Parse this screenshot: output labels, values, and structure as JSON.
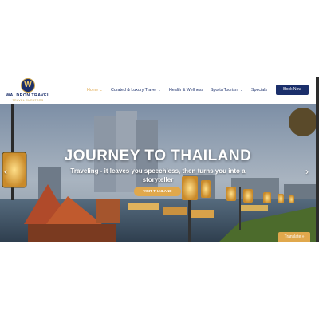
{
  "brand": {
    "name": "WALDRON TRAVEL",
    "tagline": "TRAVEL CURATORS",
    "mark_letter": "W",
    "primary_color": "#1b2f6b",
    "accent_color": "#e0a84c"
  },
  "nav": {
    "items": [
      {
        "label": "Home",
        "dropdown": true,
        "active": true
      },
      {
        "label": "Curated & Luxury Travel",
        "dropdown": true,
        "active": false
      },
      {
        "label": "Health & Wellness",
        "dropdown": false,
        "active": false
      },
      {
        "label": "Sports Tourism",
        "dropdown": true,
        "active": false
      },
      {
        "label": "Specials",
        "dropdown": false,
        "active": false
      }
    ],
    "book_button": "Book Now"
  },
  "hero": {
    "title": "JOURNEY TO THAILAND",
    "subtitle": "Traveling - it leaves you speechless, then turns you into a storyteller",
    "cta": "VISIT THAILAND",
    "prev_icon": "chevron-left-icon",
    "next_icon": "chevron-right-icon"
  },
  "translate": {
    "label": "Translate »"
  }
}
